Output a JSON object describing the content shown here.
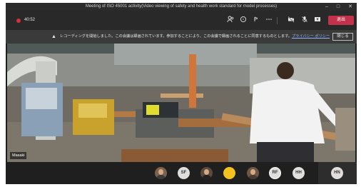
{
  "window": {
    "title": "Meeting of ISO 45001 activity(Video viewing of safety and health work standard for model processes)",
    "controls": [
      "–",
      "□",
      "✕"
    ]
  },
  "toolbar": {
    "timer": "40:52",
    "icons": [
      "people-icon",
      "chat-icon",
      "reactions-icon",
      "more-icon",
      "camera-off-icon",
      "mic-off-icon",
      "share-icon"
    ],
    "leave_label": "退出"
  },
  "banner": {
    "message": "レコーディングを開始しました。この会議は録画されています。参加することにより、この会議で録画されることに同意するものとします。",
    "link_label": "プライバシー ポリシー",
    "dismiss_label": "閉じる"
  },
  "video": {
    "participant_name": "Masaki"
  },
  "participants": [
    {
      "type": "photo",
      "initials": ""
    },
    {
      "type": "initials",
      "initials": "SF"
    },
    {
      "type": "photo",
      "initials": ""
    },
    {
      "type": "yellow",
      "initials": ""
    },
    {
      "type": "photo",
      "initials": ""
    },
    {
      "type": "initials-ring",
      "initials": "RF"
    },
    {
      "type": "initials",
      "initials": "HH"
    },
    {
      "type": "initials",
      "initials": "HN"
    }
  ],
  "colors": {
    "leave_button": "#c4314b",
    "recording_dot": "#d13438",
    "link": "#8fb4ff"
  }
}
